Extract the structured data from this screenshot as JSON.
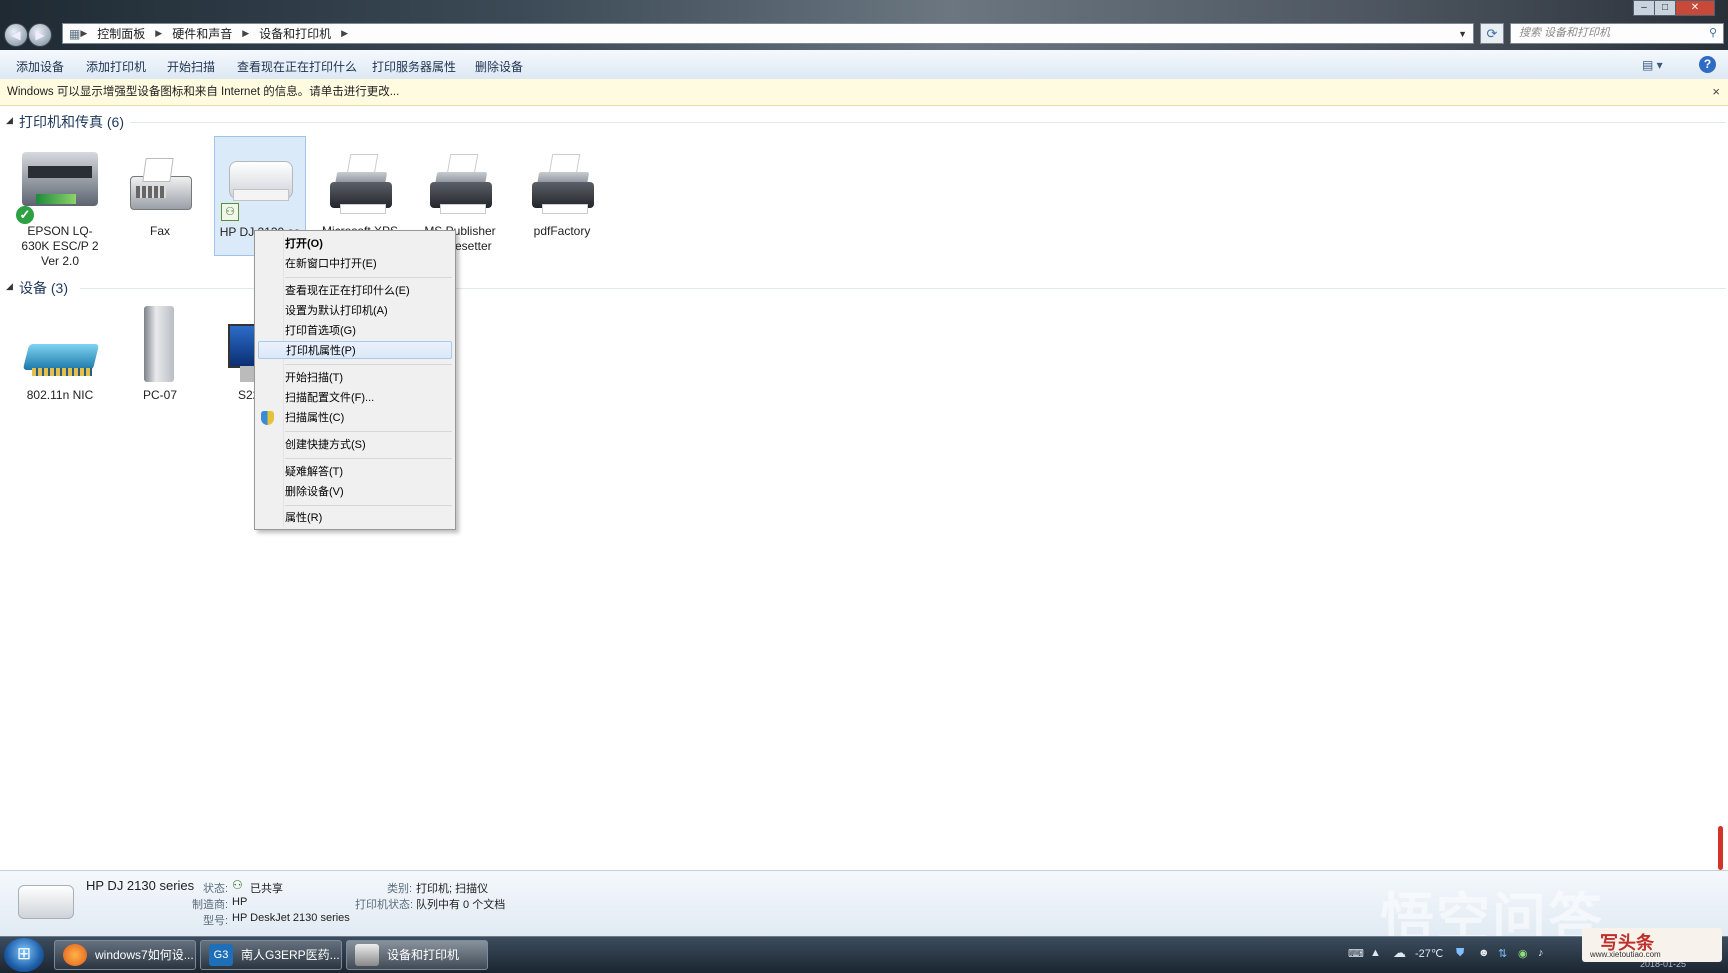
{
  "window": {
    "breadcrumbs": [
      "控制面板",
      "硬件和声音",
      "设备和打印机"
    ],
    "search_placeholder": "搜索 设备和打印机"
  },
  "toolbar": {
    "items": [
      "添加设备",
      "添加打印机",
      "开始扫描",
      "查看现在正在打印什么",
      "打印服务器属性",
      "删除设备"
    ]
  },
  "infobar": {
    "text": "Windows 可以显示增强型设备图标和来自 Internet 的信息。请单击进行更改...",
    "close": "×"
  },
  "groups": {
    "printers": {
      "title": "打印机和传真 (6)",
      "items": [
        {
          "label": "EPSON LQ-630K ESC/P 2 Ver 2.0",
          "default": true
        },
        {
          "label": "Fax"
        },
        {
          "label": "HP DJ 2130 se"
        },
        {
          "label": "Microsoft XPS"
        },
        {
          "label": "MS Publisher Imagesetter"
        },
        {
          "label": "pdfFactory"
        }
      ]
    },
    "devices": {
      "title": "设备 (3)",
      "items": [
        {
          "label": "802.11n NIC"
        },
        {
          "label": "PC-07"
        },
        {
          "label": "S22"
        }
      ]
    }
  },
  "context_menu": {
    "items": [
      {
        "label": "打开(O)",
        "bold": true
      },
      {
        "label": "在新窗口中打开(E)"
      },
      {
        "label": "查看现在正在打印什么(E)"
      },
      {
        "label": "设置为默认打印机(A)"
      },
      {
        "label": "打印首选项(G)"
      },
      {
        "label": "打印机属性(P)",
        "highlighted": true
      },
      {
        "label": "开始扫描(T)"
      },
      {
        "label": "扫描配置文件(F)..."
      },
      {
        "label": "扫描属性(C)",
        "icon": "shield-icon"
      },
      {
        "label": "创建快捷方式(S)"
      },
      {
        "label": "疑难解答(T)"
      },
      {
        "label": "删除设备(V)"
      },
      {
        "label": "属性(R)"
      }
    ]
  },
  "details": {
    "name": "HP DJ 2130 series",
    "status_label": "状态:",
    "status_value": "已共享",
    "manufacturer_label": "制造商:",
    "manufacturer_value": "HP",
    "model_label": "型号:",
    "model_value": "HP DeskJet 2130 series",
    "category_label": "类别:",
    "category_value": "打印机; 扫描仪",
    "printer_status_label": "打印机状态:",
    "printer_status_value": "队列中有 0 个文档"
  },
  "taskbar": {
    "tasks": [
      {
        "label": "windows7如何设..."
      },
      {
        "label": "南人G3ERP医药..."
      },
      {
        "label": "设备和打印机",
        "active": true
      }
    ],
    "temperature": "-27℃",
    "date": "2018-01-25"
  },
  "watermark": {
    "text": "悟空问答",
    "brand": "写头条",
    "brand_url": "www.xietoutiao.com"
  },
  "colors": {
    "selection": "#dbeaf8",
    "infobar": "#fffbe1",
    "accent": "#2d6bc4"
  }
}
